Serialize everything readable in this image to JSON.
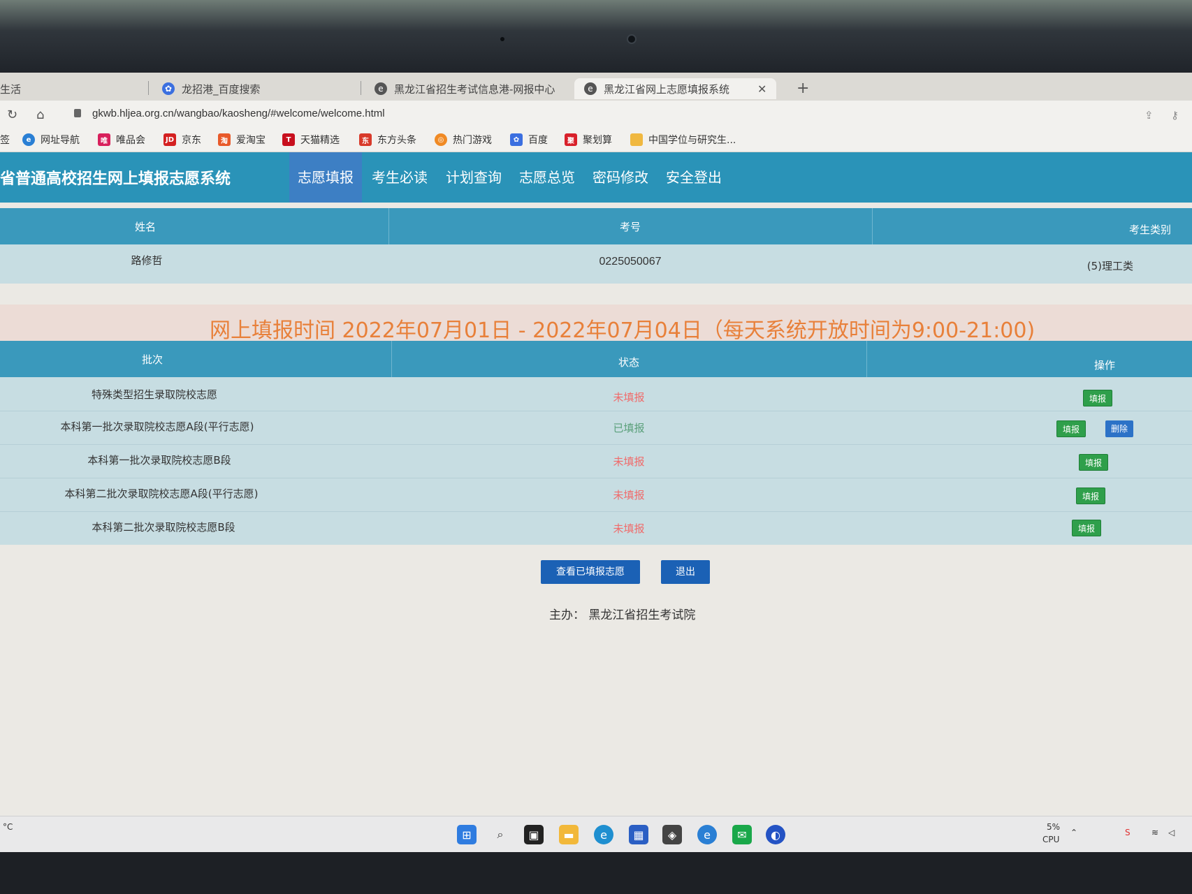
{
  "browser": {
    "tabs": [
      {
        "label": "生活"
      },
      {
        "label": "龙招港_百度搜索"
      },
      {
        "label": "黑龙江省招生考试信息港-网报中心"
      },
      {
        "label": "黑龙江省网上志愿填报系统"
      }
    ],
    "url": "gkwb.hljea.org.cn/wangbao/kaosheng/#welcome/welcome.html",
    "bookmarks": [
      {
        "label": "签"
      },
      {
        "label": "网址导航"
      },
      {
        "label": "唯品会"
      },
      {
        "label": "京东"
      },
      {
        "label": "爱淘宝"
      },
      {
        "label": "天猫精选"
      },
      {
        "label": "东方头条"
      },
      {
        "label": "热门游戏"
      },
      {
        "label": "百度"
      },
      {
        "label": "聚划算"
      },
      {
        "label": "中国学位与研究生..."
      }
    ]
  },
  "site": {
    "title": "省普通高校招生网上填报志愿系统",
    "menu": [
      "志愿填报",
      "考生必读",
      "计划查询",
      "志愿总览",
      "密码修改",
      "安全登出"
    ]
  },
  "student": {
    "headers": [
      "姓名",
      "考号",
      "考生类别"
    ],
    "name": "路修哲",
    "exam_no": "0225050067",
    "category": "(5)理工类"
  },
  "banner": "网上填报时间 2022年07月01日 - 2022年07月04日（每天系统开放时间为9:00-21:00)",
  "batches": {
    "headers": [
      "批次",
      "状态",
      "操作"
    ],
    "rows": [
      {
        "name": "特殊类型招生录取院校志愿",
        "status": "未填报",
        "fill": "填报"
      },
      {
        "name": "本科第一批次录取院校志愿A段(平行志愿)",
        "status": "已填报",
        "fill": "填报",
        "delete": "删除"
      },
      {
        "name": "本科第一批次录取院校志愿B段",
        "status": "未填报",
        "fill": "填报"
      },
      {
        "name": "本科第二批次录取院校志愿A段(平行志愿)",
        "status": "未填报",
        "fill": "填报"
      },
      {
        "name": "本科第二批次录取院校志愿B段",
        "status": "未填报",
        "fill": "填报"
      }
    ]
  },
  "actions": {
    "view": "查看已填报志愿",
    "exit": "退出"
  },
  "footer": "主办：  黑龙江省招生考试院",
  "taskbar": {
    "cpu_percent": "5%",
    "cpu_label": "CPU",
    "temp": "°C"
  },
  "colors": {
    "header": "#2a93b8",
    "active_menu": "#3d7fc4",
    "banner_text": "#e8803a",
    "fill_btn": "#2f9f4b",
    "delete_btn": "#2c72c7"
  }
}
